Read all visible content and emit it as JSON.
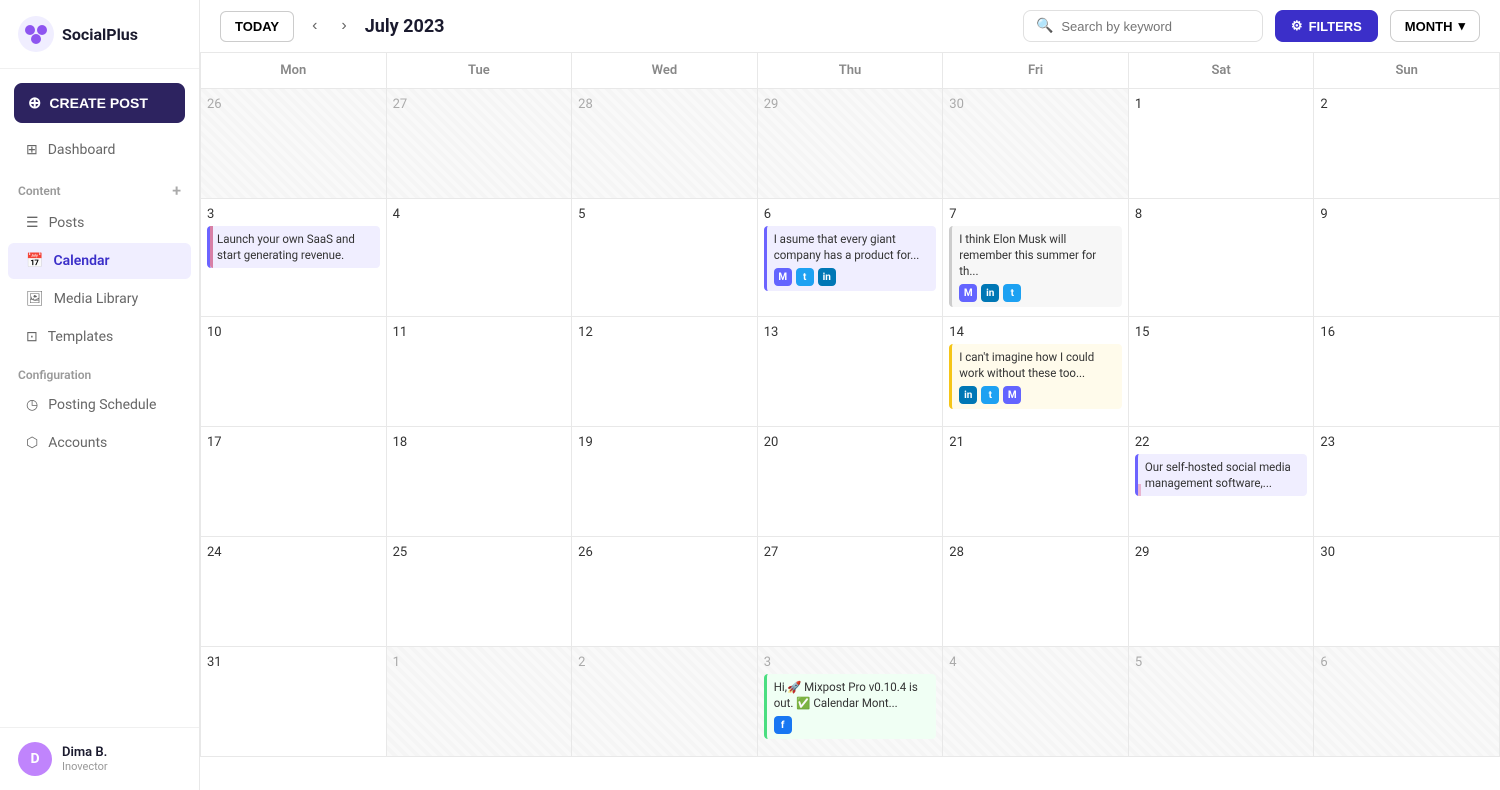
{
  "brand": {
    "name": "SocialPlus"
  },
  "sidebar": {
    "create_post_label": "CREATE POST",
    "nav_items": [
      {
        "id": "dashboard",
        "label": "Dashboard",
        "icon": "grid"
      },
      {
        "id": "posts",
        "label": "Posts",
        "icon": "file"
      },
      {
        "id": "calendar",
        "label": "Calendar",
        "icon": "calendar",
        "active": true
      },
      {
        "id": "media-library",
        "label": "Media Library",
        "icon": "image"
      },
      {
        "id": "templates",
        "label": "Templates",
        "icon": "layout"
      }
    ],
    "content_section": "Content",
    "config_section": "Configuration",
    "config_items": [
      {
        "id": "posting-schedule",
        "label": "Posting Schedule",
        "icon": "clock"
      },
      {
        "id": "accounts",
        "label": "Accounts",
        "icon": "box"
      }
    ],
    "user": {
      "name": "Dima B.",
      "org": "Inovector",
      "initials": "D"
    }
  },
  "topbar": {
    "today_label": "TODAY",
    "month_title": "July 2023",
    "search_placeholder": "Search by keyword",
    "filters_label": "FILTERS",
    "month_label": "MONTH"
  },
  "calendar": {
    "day_headers": [
      "Mon",
      "Tue",
      "Wed",
      "Thu",
      "Fri",
      "Sat",
      "Sun"
    ],
    "weeks": [
      {
        "days": [
          {
            "num": "26",
            "type": "other"
          },
          {
            "num": "27",
            "type": "other"
          },
          {
            "num": "28",
            "type": "other"
          },
          {
            "num": "29",
            "type": "other"
          },
          {
            "num": "30",
            "type": "other"
          },
          {
            "num": "1",
            "type": "current"
          },
          {
            "num": "2",
            "type": "current"
          }
        ]
      },
      {
        "days": [
          {
            "num": "3",
            "type": "current",
            "event": {
              "text": "Launch your own SaaS and start generating revenue.",
              "bar_color": "#6c63ff",
              "accent_color": "#e8b4d0",
              "has_social": false
            }
          },
          {
            "num": "4",
            "type": "current"
          },
          {
            "num": "5",
            "type": "current"
          },
          {
            "num": "6",
            "type": "current",
            "event": {
              "text": "I asume that every giant company has a product for...",
              "bar_color": "#6c63ff",
              "has_social": true,
              "social": [
                "mastodon",
                "twitter",
                "linkedin"
              ]
            }
          },
          {
            "num": "7",
            "type": "current",
            "event": {
              "text": "I think Elon Musk will remember this summer for th...",
              "bar_color": "#e8e8e8",
              "has_social": true,
              "social": [
                "mastodon",
                "linkedin",
                "twitter"
              ]
            }
          },
          {
            "num": "8",
            "type": "current"
          },
          {
            "num": "9",
            "type": "current"
          }
        ]
      },
      {
        "days": [
          {
            "num": "10",
            "type": "current"
          },
          {
            "num": "11",
            "type": "current"
          },
          {
            "num": "12",
            "type": "current"
          },
          {
            "num": "13",
            "type": "current"
          },
          {
            "num": "14",
            "type": "current",
            "event": {
              "text": "I can't imagine how I could work without these too...",
              "bar_color": "#f5c518",
              "has_social": true,
              "social": [
                "linkedin",
                "twitter",
                "mastodon"
              ]
            }
          },
          {
            "num": "15",
            "type": "current"
          },
          {
            "num": "16",
            "type": "current"
          }
        ]
      },
      {
        "days": [
          {
            "num": "17",
            "type": "current"
          },
          {
            "num": "18",
            "type": "current"
          },
          {
            "num": "19",
            "type": "current"
          },
          {
            "num": "20",
            "type": "current"
          },
          {
            "num": "21",
            "type": "current"
          },
          {
            "num": "22",
            "type": "current",
            "event": {
              "text": "Our self-hosted social media management software,...",
              "bar_color": "#6c63ff",
              "accent_color": "#e8b4d0",
              "has_social": false
            }
          },
          {
            "num": "23",
            "type": "current"
          }
        ]
      },
      {
        "days": [
          {
            "num": "24",
            "type": "current"
          },
          {
            "num": "25",
            "type": "current"
          },
          {
            "num": "26",
            "type": "current"
          },
          {
            "num": "27",
            "type": "current"
          },
          {
            "num": "28",
            "type": "current"
          },
          {
            "num": "29",
            "type": "current"
          },
          {
            "num": "30",
            "type": "current"
          }
        ]
      },
      {
        "days": [
          {
            "num": "31",
            "type": "current"
          },
          {
            "num": "1",
            "type": "other"
          },
          {
            "num": "2",
            "type": "other"
          },
          {
            "num": "3",
            "type": "other",
            "event": {
              "text": "Hi,🚀 Mixpost Pro v0.10.4 is out. ✅ Calendar Mont...",
              "bar_color": "#4ade80",
              "has_social": true,
              "social": [
                "facebook"
              ]
            }
          },
          {
            "num": "4",
            "type": "other"
          },
          {
            "num": "5",
            "type": "other"
          },
          {
            "num": "6",
            "type": "other"
          }
        ]
      }
    ]
  }
}
